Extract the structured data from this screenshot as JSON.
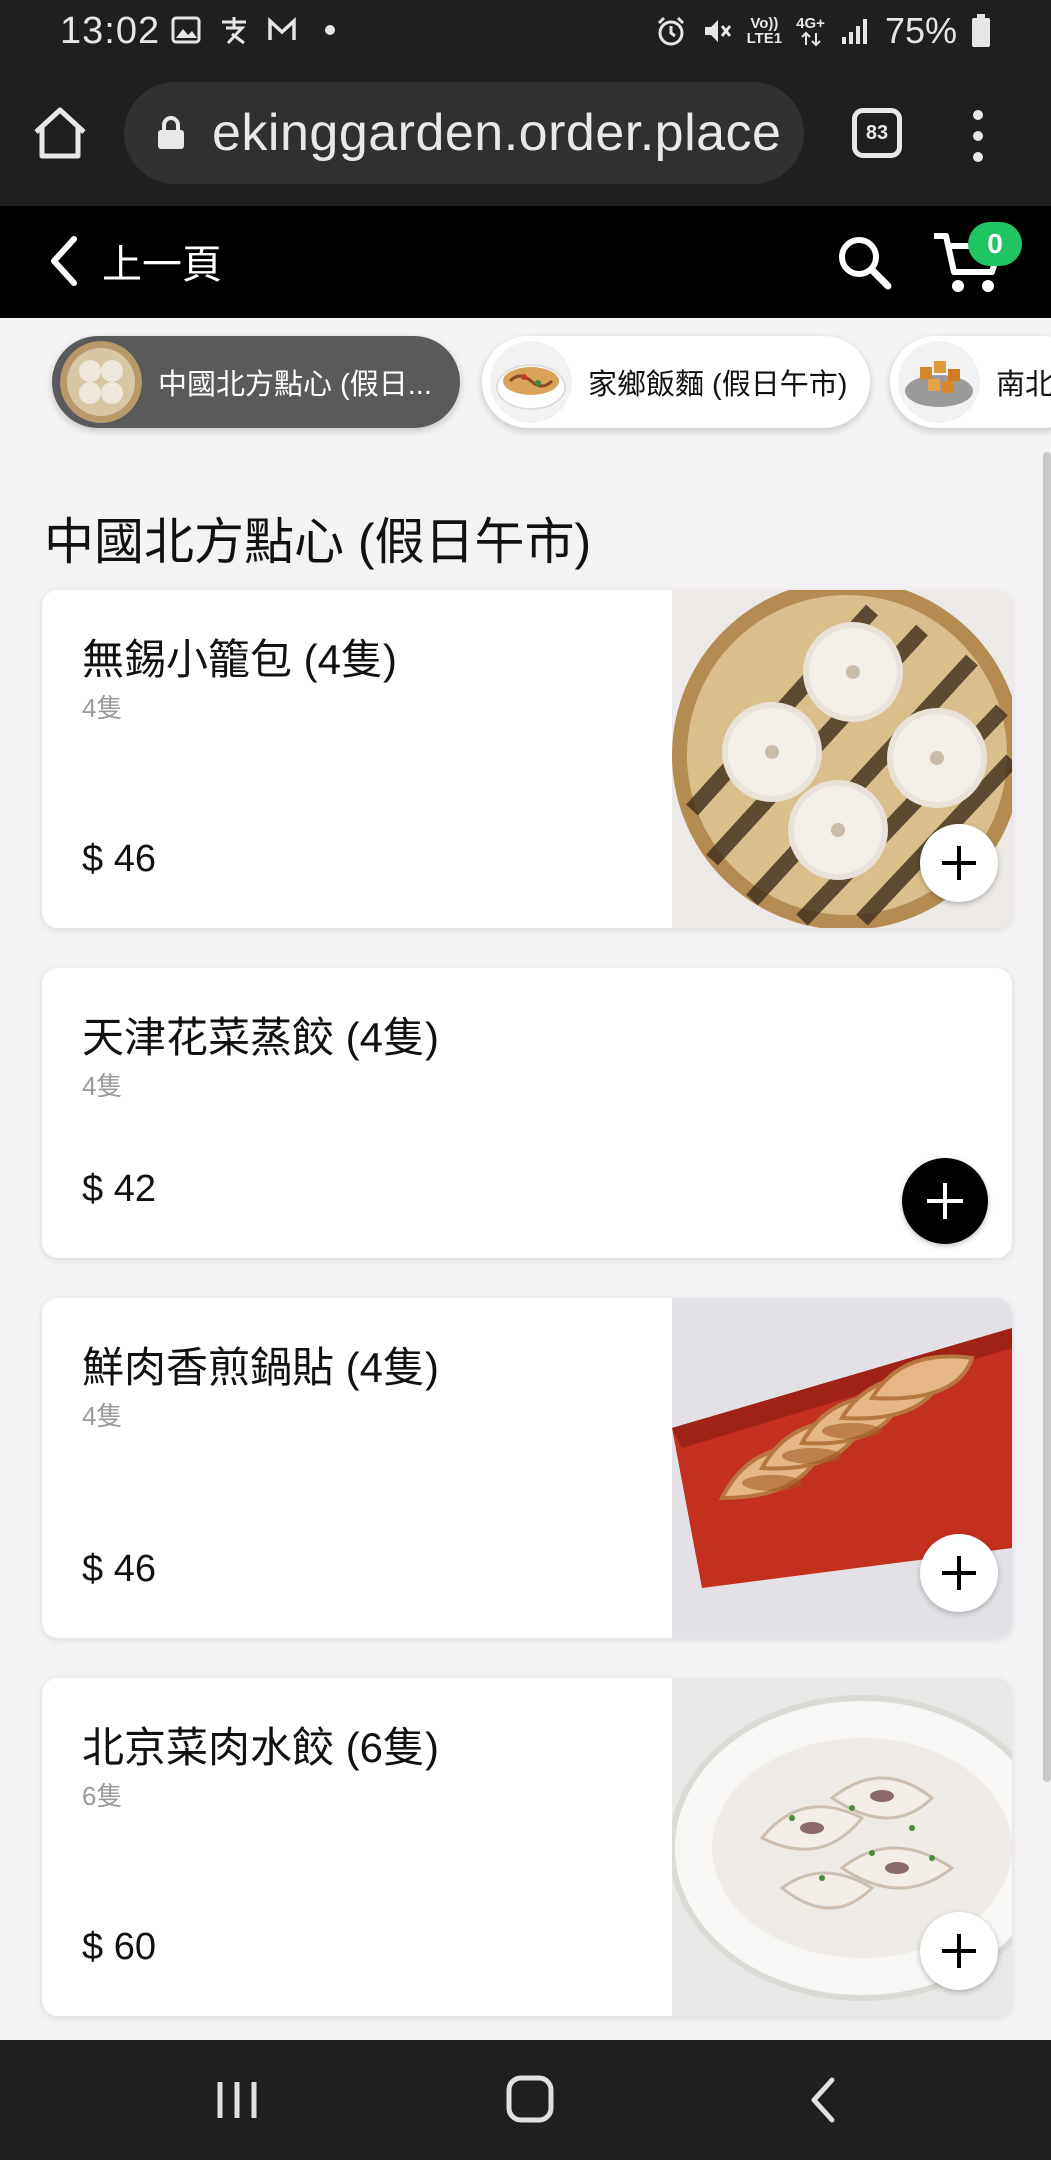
{
  "status_bar": {
    "time": "13:02",
    "network_top": "Vo))",
    "network_bottom": "LTE1",
    "network_gen": "4G+",
    "battery": "75%"
  },
  "browser": {
    "url": "ekinggarden.order.place",
    "tab_count": "83"
  },
  "site_header": {
    "back_label": "上一頁",
    "cart_count": "0"
  },
  "categories": [
    {
      "label": "中國北方點心 (假日...",
      "active": true,
      "thumb_icon": "xiaolongbao-thumb"
    },
    {
      "label": "家鄉飯麵 (假日午市)",
      "active": false,
      "thumb_icon": "noodle-bowl-thumb"
    },
    {
      "label": "南北...",
      "active": false,
      "thumb_icon": "fried-snack-thumb"
    }
  ],
  "section_title": "中國北方點心 (假日午市)",
  "items": [
    {
      "name": "無錫小籠包 (4隻)",
      "desc": "4隻",
      "price": "$ 46",
      "image": "xiaolongbao-steamer-photo"
    },
    {
      "name": "天津花菜蒸餃 (4隻)",
      "desc": "4隻",
      "price": "$ 42",
      "image": ""
    },
    {
      "name": "鮮肉香煎鍋貼 (4隻)",
      "desc": "4隻",
      "price": "$ 46",
      "image": "potstickers-red-plate-photo"
    },
    {
      "name": "北京菜肉水餃 (6隻)",
      "desc": "6隻",
      "price": "$ 60",
      "image": "dumplings-soup-bowl-photo"
    }
  ],
  "colors": {
    "badge_green": "#1fc463",
    "header_black": "#000000",
    "chrome_dark": "#1f1f1f",
    "content_bg": "#f4f2f4"
  }
}
